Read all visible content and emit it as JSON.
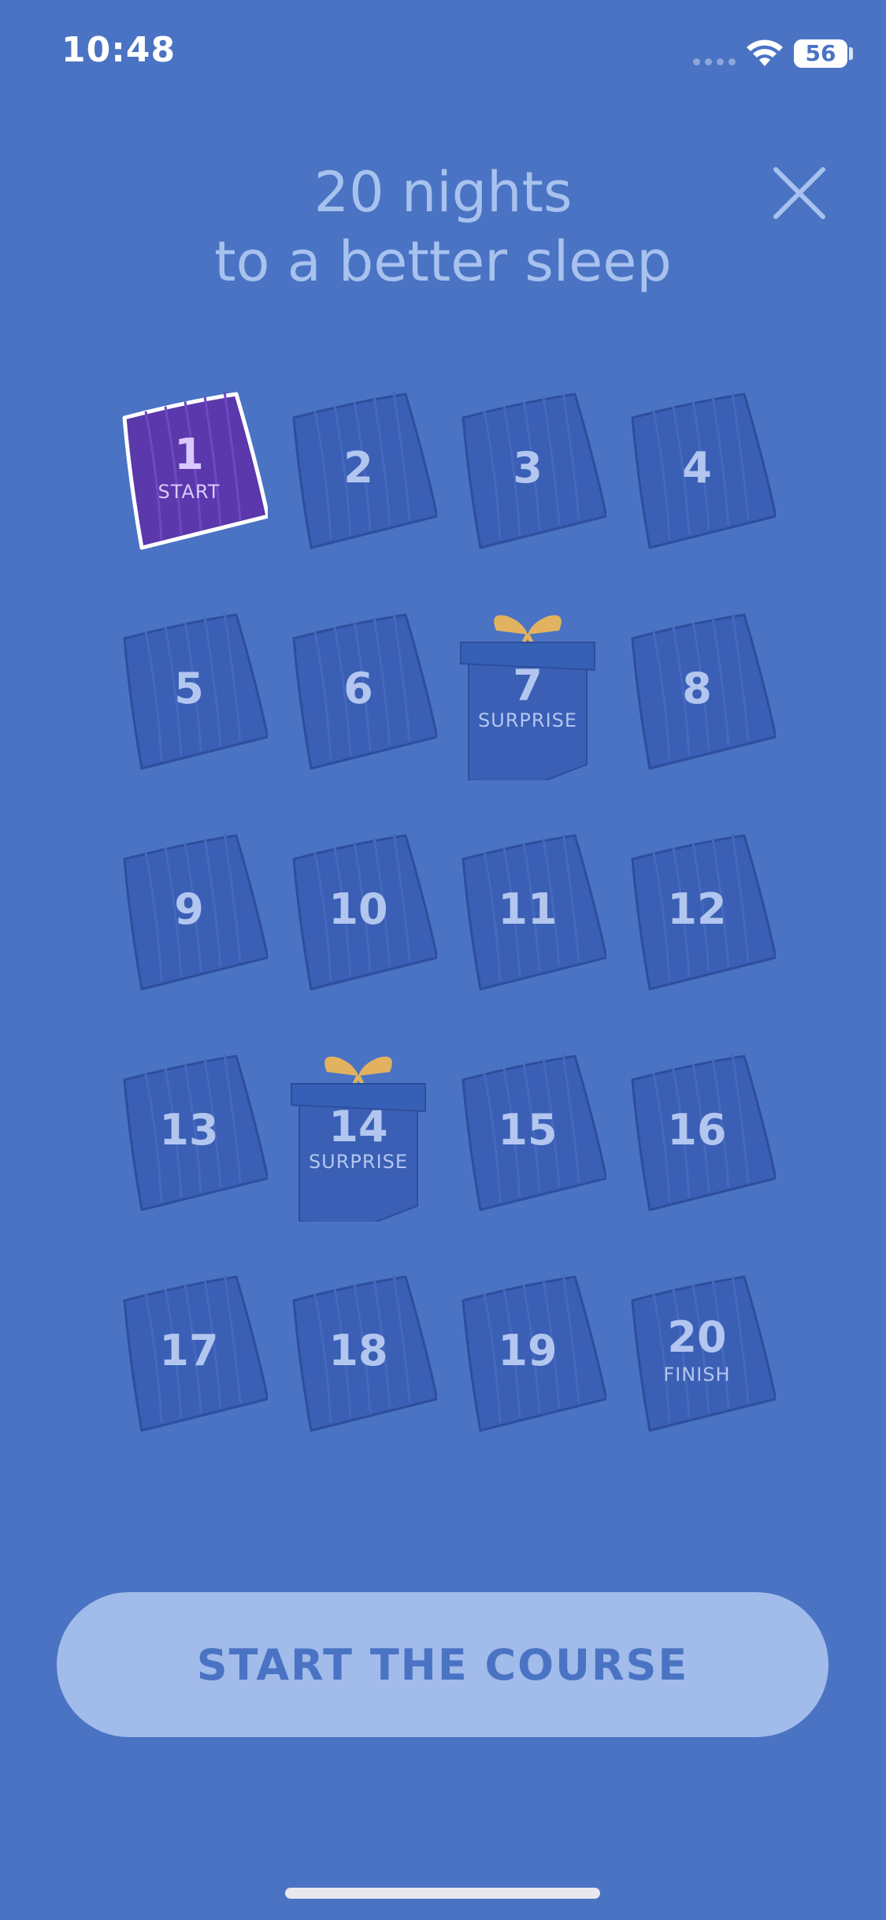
{
  "status_bar": {
    "time": "10:48",
    "battery": "56"
  },
  "header": {
    "title_line1": "20 nights",
    "title_line2": "to a better sleep"
  },
  "colors": {
    "background": "#4a73c4",
    "pillow": "#3a5fb5",
    "pillow_active": "#5b38ab",
    "button": "#a1bbea",
    "title": "#a8c2ee",
    "ribbon": "#e2b260"
  },
  "nights": [
    {
      "num": "1",
      "sub": "START",
      "type": "pillow",
      "active": true
    },
    {
      "num": "2",
      "sub": "",
      "type": "pillow",
      "active": false
    },
    {
      "num": "3",
      "sub": "",
      "type": "pillow",
      "active": false
    },
    {
      "num": "4",
      "sub": "",
      "type": "pillow",
      "active": false
    },
    {
      "num": "5",
      "sub": "",
      "type": "pillow",
      "active": false
    },
    {
      "num": "6",
      "sub": "",
      "type": "pillow",
      "active": false
    },
    {
      "num": "7",
      "sub": "SURPRISE",
      "type": "gift",
      "active": false
    },
    {
      "num": "8",
      "sub": "",
      "type": "pillow",
      "active": false
    },
    {
      "num": "9",
      "sub": "",
      "type": "pillow",
      "active": false
    },
    {
      "num": "10",
      "sub": "",
      "type": "pillow",
      "active": false
    },
    {
      "num": "11",
      "sub": "",
      "type": "pillow",
      "active": false
    },
    {
      "num": "12",
      "sub": "",
      "type": "pillow",
      "active": false
    },
    {
      "num": "13",
      "sub": "",
      "type": "pillow",
      "active": false
    },
    {
      "num": "14",
      "sub": "SURPRISE",
      "type": "gift",
      "active": false
    },
    {
      "num": "15",
      "sub": "",
      "type": "pillow",
      "active": false
    },
    {
      "num": "16",
      "sub": "",
      "type": "pillow",
      "active": false
    },
    {
      "num": "17",
      "sub": "",
      "type": "pillow",
      "active": false
    },
    {
      "num": "18",
      "sub": "",
      "type": "pillow",
      "active": false
    },
    {
      "num": "19",
      "sub": "",
      "type": "pillow",
      "active": false
    },
    {
      "num": "20",
      "sub": "FINISH",
      "type": "pillow",
      "active": false
    }
  ],
  "cta": {
    "label": "START THE COURSE"
  },
  "icons": {
    "close": "close-icon",
    "wifi": "wifi-icon",
    "pillow": "pillow-icon",
    "gift": "gift-icon"
  }
}
